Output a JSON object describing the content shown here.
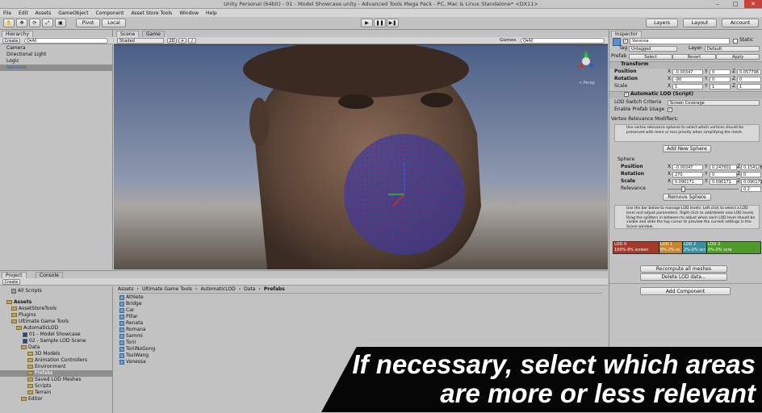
{
  "window": {
    "title": "Unity Personal (64bit) - 01 - Model Showcase.unity - Advanced Tools Mega Pack - PC, Mac & Linux Standalone* <DX11>"
  },
  "menu": [
    "File",
    "Edit",
    "Assets",
    "GameObject",
    "Component",
    "Asset Store Tools",
    "Window",
    "Help"
  ],
  "toolbar": {
    "pivot": "Pivot",
    "local": "Local",
    "layers": "Layers",
    "layout": "Layout",
    "account": "Account"
  },
  "hierarchy": {
    "tab": "Hierarchy",
    "create": "Create",
    "search": "Q▾All",
    "items": [
      "Camera",
      "Directional Light",
      "Logic",
      "Vanessa"
    ]
  },
  "scene": {
    "tab_scene": "Scene",
    "tab_game": "Game",
    "shading": "Shaded",
    "mode2d": "2D",
    "gizmos": "Gizmos",
    "search": "Q▾All",
    "persp": "< Persp"
  },
  "project": {
    "tab_project": "Project",
    "tab_console": "Console",
    "create": "Create",
    "all_scripts": "All Scripts",
    "tree": [
      "Assets",
      "AssetStoreTools",
      "Plugins",
      "Ultimate Game Tools",
      "AutomaticLOD",
      "01 - Model Showcase",
      "02 - Sample LOD Scene",
      "Data",
      "3D Models",
      "Animation Controllers",
      "Environment",
      "Prefabs",
      "Saved LOD Meshes",
      "Scripts",
      "Terrain",
      "Editor"
    ],
    "breadcrumb": [
      "Assets",
      "Ultimate Game Tools",
      "AutomaticLOD",
      "Data",
      "Prefabs"
    ],
    "files": [
      "Athlete",
      "Bridge",
      "Car",
      "Pillar",
      "Renata",
      "Romana",
      "Sammi",
      "Torii",
      "ToriiNoGong",
      "TsuiWang",
      "Vanessa"
    ]
  },
  "inspector": {
    "tab": "Inspector",
    "name": "Vanessa",
    "static": "Static",
    "tag_label": "Tag",
    "tag_value": "Untagged",
    "layer_label": "Layer",
    "layer_value": "Default",
    "prefab": "Prefab",
    "select": "Select",
    "revert": "Revert",
    "apply": "Apply",
    "transform": {
      "title": "Transform",
      "position": "Position",
      "rotation": "Rotation",
      "scale": "Scale",
      "pos": [
        "-0.00347",
        "0",
        "0.057798"
      ],
      "rot": [
        "-90",
        "0",
        "0"
      ],
      "scl": [
        "1",
        "1",
        "1"
      ]
    },
    "autolod": {
      "title": "Automatic LOD (Script)",
      "criteria_label": "LOD Switch Criteria",
      "criteria_value": "Screen Coverage",
      "prefab_usage": "Enable Prefab Usage",
      "vertex_mod": "Vertex Relevance Modifiers:",
      "help1": "Use vertex relevance spheres to select which vertices should be preserved with more or less priority when simplifying the mesh.",
      "add_sphere": "Add New Sphere",
      "sphere": "Sphere",
      "position": "Position",
      "rotation": "Rotation",
      "scale": "Scale",
      "relevance": "Relevance",
      "spos": [
        "-0.00347",
        "0.247602",
        "0.154126"
      ],
      "srot": [
        "270",
        "0",
        "0"
      ],
      "sscl": [
        "0.090171",
        "0.090171",
        "0.090171"
      ],
      "rel": "0.2",
      "remove_sphere": "Remove Sphere",
      "help2": "Use the bar below to manage LOD levels: Left click to select a LOD level and adjust parameters. Right click to add/delete new LOD levels. Drag the splitters in between to adjust when each LOD level should be visible and slide the top cursor to preview the current settings in the Scene window.",
      "lods": [
        {
          "name": "LOD 0",
          "range": "100%-9% screen",
          "color": "#a53a2c"
        },
        {
          "name": "LOD 1",
          "range": "9%-2% sc",
          "color": "#c5862f"
        },
        {
          "name": "LOD 2",
          "range": "2%-0% scr",
          "color": "#3b8fa0"
        },
        {
          "name": "LOD 3",
          "range": "0%-0% scre",
          "color": "#4f9a2a"
        }
      ],
      "recompute": "Recompute all meshes",
      "delete": "Delete LOD data..."
    },
    "add_component": "Add Component"
  },
  "caption": {
    "line1": "If necessary, select which areas",
    "line2": "are more or less relevant"
  }
}
